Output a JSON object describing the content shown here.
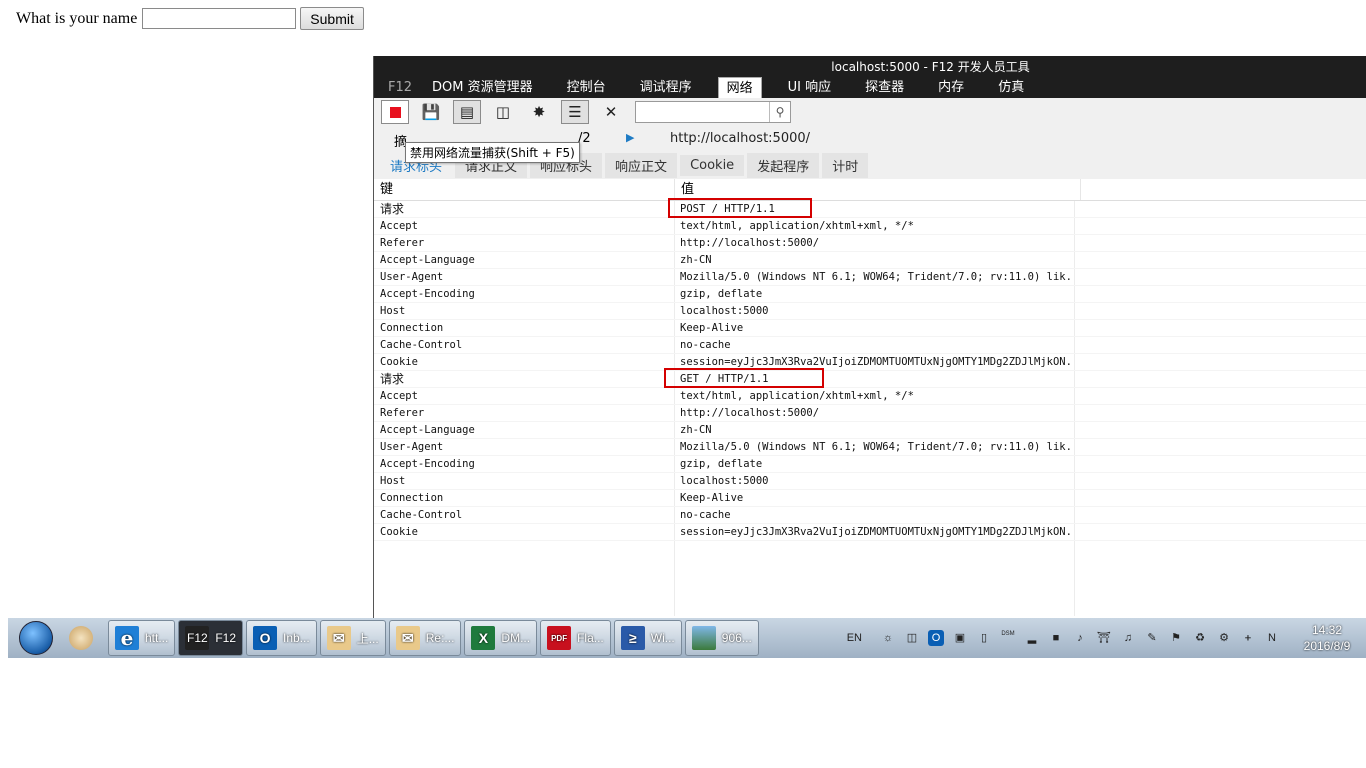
{
  "form": {
    "label": "What is your name",
    "input_value": "",
    "submit_label": "Submit"
  },
  "devtools": {
    "title": "localhost:5000 - F12 开发人员工具",
    "tabs": [
      "F12",
      "DOM 资源管理器",
      "控制台",
      "调试程序",
      "网络",
      "UI 响应",
      "探查器",
      "内存",
      "仿真"
    ],
    "active_tab": "网络",
    "tooltip": "禁用网络流量捕获(Shift + F5)",
    "url_row": {
      "left_label": "摘",
      "right_label": "/2",
      "url": "http://localhost:5000/"
    },
    "detail_tabs": [
      "请求标头",
      "请求正文",
      "响应标头",
      "响应正文",
      "Cookie",
      "发起程序",
      "计时"
    ],
    "columns": {
      "key": "键",
      "value": "值"
    },
    "rows": [
      {
        "k": "请求",
        "v": "POST / HTTP/1.1"
      },
      {
        "k": "Accept",
        "v": "text/html, application/xhtml+xml, */*"
      },
      {
        "k": "Referer",
        "v": "http://localhost:5000/"
      },
      {
        "k": "Accept-Language",
        "v": "zh-CN"
      },
      {
        "k": "User-Agent",
        "v": "Mozilla/5.0 (Windows NT 6.1; WOW64; Trident/7.0; rv:11.0) lik..."
      },
      {
        "k": "Accept-Encoding",
        "v": "gzip, deflate"
      },
      {
        "k": "Host",
        "v": "localhost:5000"
      },
      {
        "k": "Connection",
        "v": "Keep-Alive"
      },
      {
        "k": "Cache-Control",
        "v": "no-cache"
      },
      {
        "k": "Cookie",
        "v": "session=eyJjc3JmX3Rva2VuIjoiZDMOMTUOMTUxNjgOMTY1MDg2ZDJlMjkON..."
      },
      {
        "k": "请求",
        "v": "GET / HTTP/1.1"
      },
      {
        "k": "Accept",
        "v": "text/html, application/xhtml+xml, */*"
      },
      {
        "k": "Referer",
        "v": "http://localhost:5000/"
      },
      {
        "k": "Accept-Language",
        "v": "zh-CN"
      },
      {
        "k": "User-Agent",
        "v": "Mozilla/5.0 (Windows NT 6.1; WOW64; Trident/7.0; rv:11.0) lik..."
      },
      {
        "k": "Accept-Encoding",
        "v": "gzip, deflate"
      },
      {
        "k": "Host",
        "v": "localhost:5000"
      },
      {
        "k": "Connection",
        "v": "Keep-Alive"
      },
      {
        "k": "Cache-Control",
        "v": "no-cache"
      },
      {
        "k": "Cookie",
        "v": "session=eyJjc3JmX3Rva2VuIjoiZDMOMTUOMTUxNjgOMTY1MDg2ZDJlMjkON..."
      }
    ]
  },
  "taskbar": {
    "items": [
      {
        "label": "",
        "icon": "paint-icon"
      },
      {
        "label": "htt...",
        "icon": "ie-icon"
      },
      {
        "label": "F12",
        "icon": "f12-icon",
        "icon_text": "F12"
      },
      {
        "label": "Inb...",
        "icon": "outlook-icon",
        "icon_text": "O"
      },
      {
        "label": "上...",
        "icon": "mail-icon"
      },
      {
        "label": "Re:...",
        "icon": "mail-icon"
      },
      {
        "label": "DM...",
        "icon": "excel-icon",
        "icon_text": "X"
      },
      {
        "label": "Fla...",
        "icon": "pdf-icon",
        "icon_text": "PDF"
      },
      {
        "label": "Wi...",
        "icon": "powershell-icon",
        "icon_text": "≥"
      },
      {
        "label": "906...",
        "icon": "image-icon"
      }
    ],
    "lang": "EN",
    "tray_label": "DSM",
    "clock_time": "14:32",
    "clock_date": "2016/8/9",
    "colors": {
      "accent": "#1e7bc4",
      "highlight_box": "#d40000",
      "record": "#e8101e"
    }
  }
}
